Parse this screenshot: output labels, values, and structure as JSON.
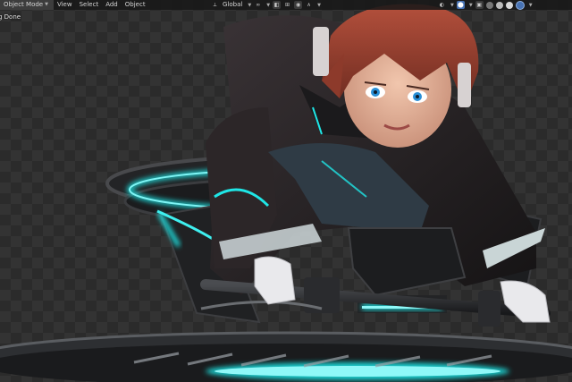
{
  "header": {
    "mode_label": "Object Mode",
    "menus": [
      "View",
      "Select",
      "Add",
      "Object"
    ],
    "transform_orientation": "Global"
  },
  "status_text": "g Done",
  "icons": {
    "mode": "object-mode-icon",
    "orientation": "global-axes-icon",
    "pivot": "link-icon",
    "snap": "snap-magnet-icon",
    "proportional": "proportional-edit-icon",
    "overlay": "overlay-icon",
    "xray": "xray-icon",
    "shading": [
      "wireframe-shading-icon",
      "solid-shading-icon",
      "material-shading-icon",
      "rendered-shading-icon"
    ]
  },
  "colors": {
    "header_bg": "#181818",
    "active": "#4772b3",
    "glow": "#1fe6e6"
  }
}
